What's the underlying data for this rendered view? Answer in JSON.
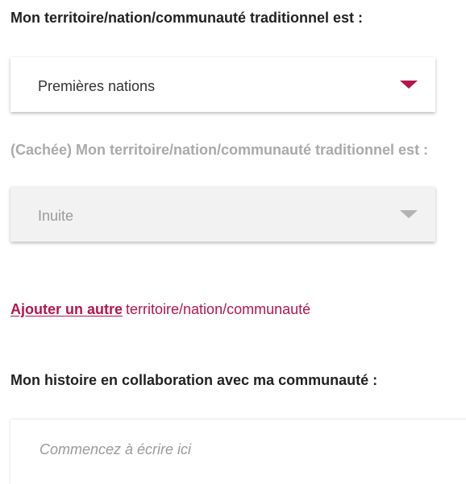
{
  "territory": {
    "label": "Mon territoire/nation/communauté traditionnel est :",
    "selected": "Premières nations"
  },
  "hidden_territory": {
    "label": "(Cachée) Mon territoire/nation/communauté traditionnel est :",
    "selected": "Inuite"
  },
  "add_another": {
    "link": "Ajouter un autre",
    "rest": "territoire/nation/communauté"
  },
  "story": {
    "label": "Mon histoire en collaboration avec ma communauté :",
    "placeholder": "Commencez à écrire ici"
  },
  "colors": {
    "accent": "#b5164b",
    "muted_text": "#aaaaaa",
    "disabled_bg": "#f2f2f2"
  }
}
